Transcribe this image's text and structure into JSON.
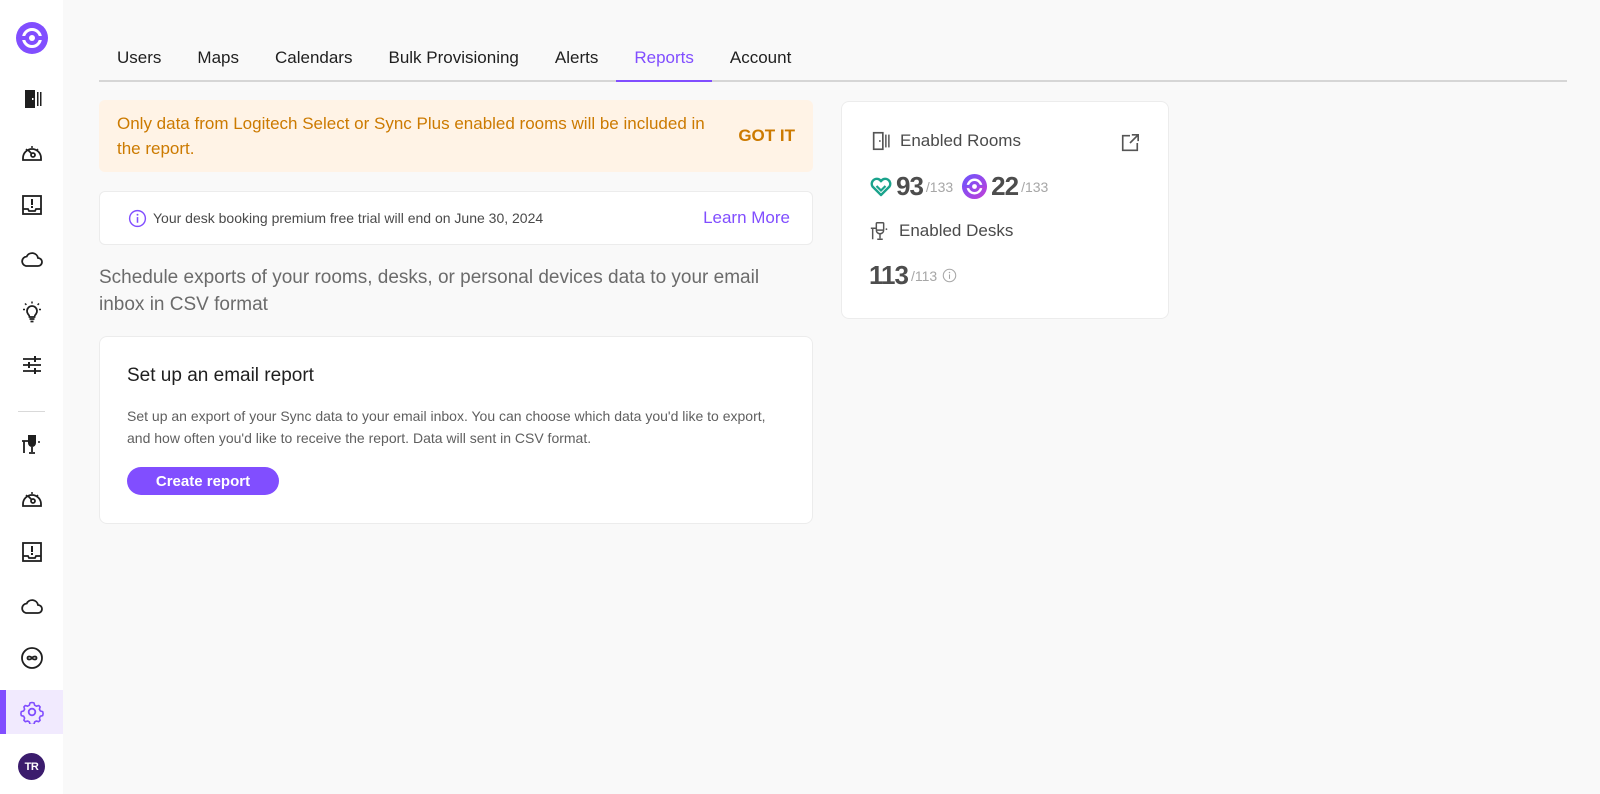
{
  "sidebar": {
    "items": [
      {
        "name": "rooms",
        "icon": "room-door-icon"
      },
      {
        "name": "rooms-insights",
        "icon": "speedometer-icon"
      },
      {
        "name": "rooms-alerts",
        "icon": "alert-tray-icon"
      },
      {
        "name": "rooms-cloud",
        "icon": "cloud-icon"
      },
      {
        "name": "rooms-recommendations",
        "icon": "lightbulb-icon"
      },
      {
        "name": "rooms-settings",
        "icon": "sliders-icon"
      },
      {
        "name": "desks",
        "icon": "desk-icon"
      },
      {
        "name": "desks-insights",
        "icon": "speedometer-icon"
      },
      {
        "name": "desks-alerts",
        "icon": "alert-tray-icon"
      },
      {
        "name": "desks-cloud",
        "icon": "cloud-icon"
      },
      {
        "name": "integrations",
        "icon": "infinity-icon"
      },
      {
        "name": "settings",
        "icon": "gear-icon",
        "active": true
      }
    ],
    "avatar_initials": "TR"
  },
  "tabs": [
    {
      "label": "Users"
    },
    {
      "label": "Maps"
    },
    {
      "label": "Calendars"
    },
    {
      "label": "Bulk Provisioning"
    },
    {
      "label": "Alerts"
    },
    {
      "label": "Reports",
      "active": true
    },
    {
      "label": "Account"
    }
  ],
  "banner": {
    "text": "Only data from Logitech Select or Sync Plus enabled rooms will be included in the report.",
    "action": "GOT IT"
  },
  "trial": {
    "text": "Your desk booking premium free trial will end on June 30, 2024",
    "link": "Learn More"
  },
  "intro": "Schedule exports of your rooms, desks, or personal devices data to your email inbox in CSV format",
  "report_card": {
    "title": "Set up an email report",
    "description": "Set up an export of your Sync data to your email inbox. You can choose which data you'd like to export, and how often you'd like to receive the report. Data will sent in CSV format.",
    "button": "Create report"
  },
  "stats": {
    "rooms_label": "Enabled Rooms",
    "select_count": "93",
    "select_total": "/133",
    "syncplus_count": "22",
    "syncplus_total": "/133",
    "desks_label": "Enabled Desks",
    "desks_count": "113",
    "desks_total": "/113"
  },
  "colors": {
    "accent": "#814eff",
    "banner_text": "#cc7a00",
    "banner_bg": "#fff3e6",
    "select_teal": "#1aa38c",
    "avatar_bg": "#3b1c6d"
  }
}
